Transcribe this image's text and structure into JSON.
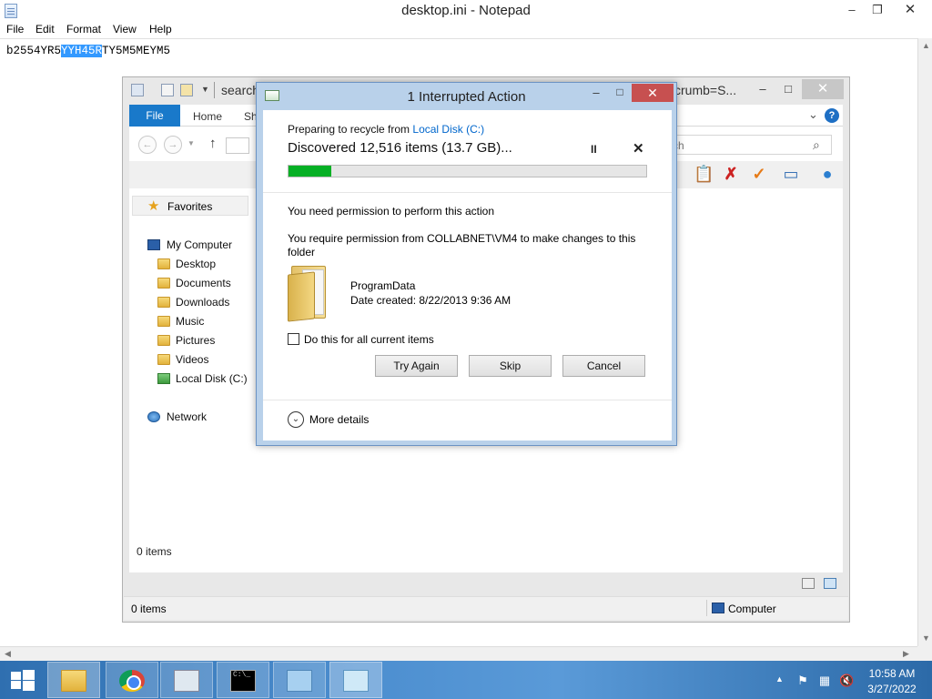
{
  "notepad": {
    "title": "desktop.ini - Notepad",
    "menu": [
      "File",
      "Edit",
      "Format",
      "View",
      "Help"
    ],
    "controls": {
      "minimize": "–",
      "maximize": "❐",
      "close": "✕"
    },
    "text_before": "b2554YR5",
    "text_selected": "YYH45R",
    "text_after": "TY5M5MEYM5"
  },
  "explorer": {
    "title_search_fragment": "search",
    "title_crumb_fragment": "crumb=S...",
    "tabs": {
      "file": "File",
      "home": "Home",
      "share": "Sh"
    },
    "search_placeholder": "ch",
    "favorites": "Favorites",
    "tree": {
      "my_computer": "My Computer",
      "desktop": "Desktop",
      "documents": "Documents",
      "downloads": "Downloads",
      "music": "Music",
      "pictures": "Pictures",
      "videos": "Videos",
      "local_disk": "Local Disk (C:)",
      "network": "Network"
    },
    "items_count_inner": "0 items",
    "status_items": "0 items",
    "status_location": "Computer"
  },
  "dialog": {
    "title": "1 Interrupted Action",
    "preparing_prefix": "Preparing to recycle from ",
    "preparing_link": "Local Disk (C:)",
    "discovered": "Discovered 12,516 items (13.7 GB)...",
    "pause_symbol": "II",
    "cancel_symbol": "✕",
    "progress_fraction": 0.12,
    "need_permission": "You need permission to perform this action",
    "require_permission": "You require permission from COLLABNET\\VM4 to make changes to this folder",
    "folder_name": "ProgramData",
    "folder_date": "Date created: 8/22/2013 9:36 AM",
    "checkbox_label": "Do this for all current items",
    "buttons": {
      "try_again": "Try Again",
      "skip": "Skip",
      "cancel": "Cancel"
    },
    "more_details": "More details"
  },
  "taskbar": {
    "time": "10:58 AM",
    "date": "3/27/2022",
    "cmd_text": "C:\\_"
  },
  "colors": {
    "accent": "#1979ca",
    "progress": "#06b025",
    "dialog_close": "#c75050",
    "link": "#0066cc"
  }
}
